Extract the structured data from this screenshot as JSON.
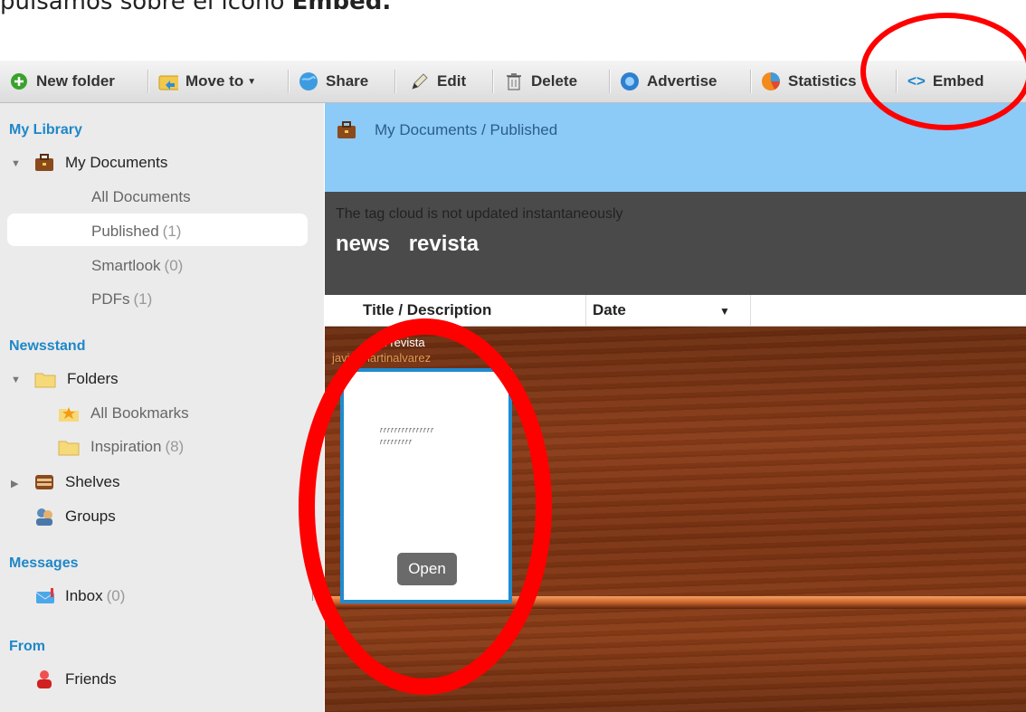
{
  "caption": {
    "prefix": "pulsamos sobre el icono ",
    "bold": "Embed."
  },
  "toolbar": {
    "new_folder": "New folder",
    "move_to": "Move to",
    "share": "Share",
    "edit": "Edit",
    "delete": "Delete",
    "advertise": "Advertise",
    "statistics": "Statistics",
    "embed": "Embed"
  },
  "sidebar": {
    "my_library": "My Library",
    "my_documents": "My Documents",
    "all_documents": "All Documents",
    "published": "Published",
    "published_count": "(1)",
    "smartlook": "Smartlook",
    "smartlook_count": "(0)",
    "pdfs": "PDFs",
    "pdfs_count": "(1)",
    "newsstand": "Newsstand",
    "folders": "Folders",
    "all_bookmarks": "All Bookmarks",
    "inspiration": "Inspiration",
    "inspiration_count": "(8)",
    "shelves": "Shelves",
    "groups": "Groups",
    "messages": "Messages",
    "inbox": "Inbox",
    "inbox_count": "(0)",
    "from": "From",
    "friends": "Friends"
  },
  "main": {
    "breadcrumb": "My Documents / Published",
    "tag_note": "The tag cloud is not updated instantaneously",
    "tags": [
      "news",
      "revista"
    ],
    "col_title": "Title / Description",
    "col_date": "Date"
  },
  "document": {
    "title": "Mi revista",
    "author": "javiermartinalvarez",
    "preview_line1": "rrrrrrrrrrrrrrr",
    "preview_line2": "rrrrrrrrr",
    "open_label": "Open"
  },
  "colors": {
    "annotation": "#ff0000",
    "link_blue": "#1e87c8",
    "crumb_bg": "#8ccaf8"
  }
}
